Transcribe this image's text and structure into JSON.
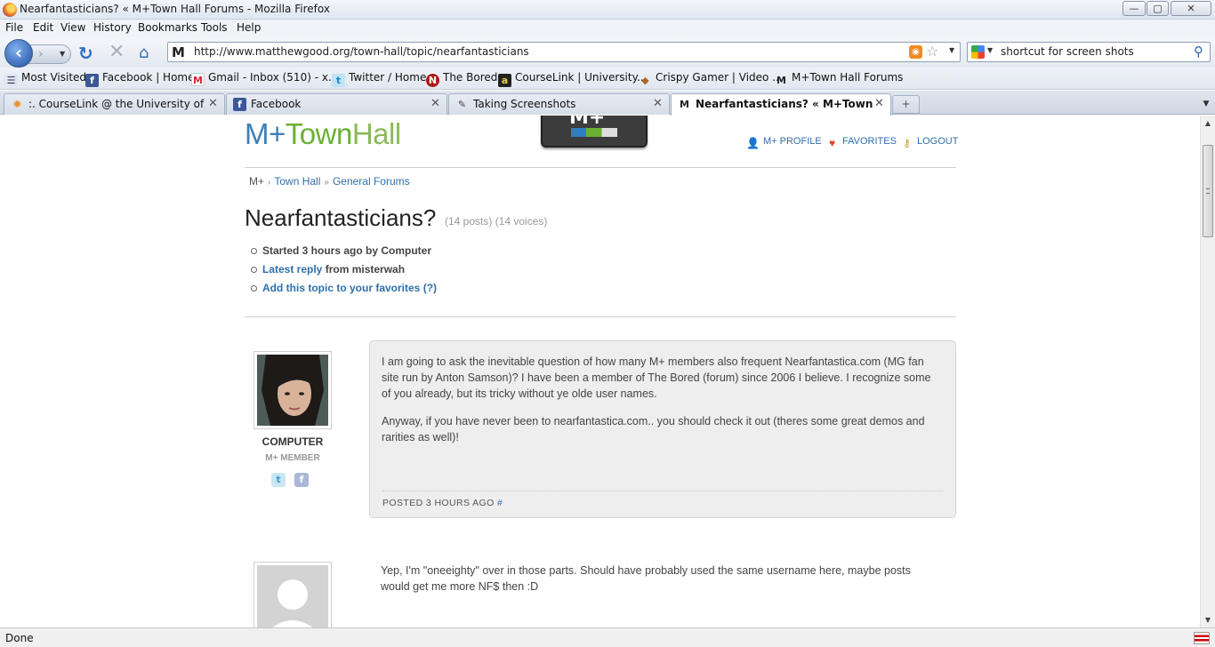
{
  "window": {
    "title": "Nearfantasticians? « M+Town Hall Forums - Mozilla Firefox",
    "min_glyph": "—",
    "max_glyph": "▢",
    "close_glyph": "✕"
  },
  "menu": [
    "File",
    "Edit",
    "View",
    "History",
    "Bookmarks",
    "Tools",
    "Help"
  ],
  "nav": {
    "back_glyph": "‹",
    "forward_glyph": "›",
    "reload_glyph": "↻",
    "stop_glyph": "✕",
    "home_glyph": "⌂",
    "url": "http://www.matthewgood.org/town-hall/topic/nearfantasticians",
    "site_icon": "M",
    "search_query": "shortcut for screen shots",
    "search_glyph": "⚲"
  },
  "bookmarks": [
    {
      "label": "Most Visited",
      "icon": "most-visited-icon"
    },
    {
      "label": "Facebook | Home",
      "icon": "facebook-icon"
    },
    {
      "label": "Gmail - Inbox (510) - x...",
      "icon": "gmail-icon"
    },
    {
      "label": "Twitter / Home",
      "icon": "twitter-icon"
    },
    {
      "label": "The Bored",
      "icon": "the-bored-icon"
    },
    {
      "label": "CourseLink | University...",
      "icon": "courselink-icon"
    },
    {
      "label": "Crispy Gamer | Video ...",
      "icon": "crispy-gamer-icon"
    },
    {
      "label": "M+Town Hall Forums",
      "icon": "mplus-icon"
    }
  ],
  "tabs": [
    {
      "label": ":. CourseLink @ the University of Gu...",
      "active": false
    },
    {
      "label": "Facebook",
      "active": false
    },
    {
      "label": "Taking Screenshots",
      "active": false
    },
    {
      "label": "Nearfantasticians? « M+Town Hall...",
      "active": true
    }
  ],
  "status": "Done",
  "site": {
    "logo_m": "M+",
    "logo_town": "Town",
    "logo_hall": "Hall",
    "cassette_label": "M+",
    "user_nav": {
      "profile": "M+ PROFILE",
      "favorites": "FAVORITES",
      "logout": "LOGOUT"
    },
    "breadcrumb": {
      "root": "M+",
      "town_hall": "Town Hall",
      "general": "General Forums"
    }
  },
  "topic": {
    "title": "Nearfantasticians?",
    "meta": "(14 posts) (14 voices)",
    "started": "Started 3 hours ago by Computer",
    "latest_reply_link": "Latest reply",
    "latest_reply_from": " from misterwah",
    "add_favorites_link": "Add this topic to your favorites",
    "help_link": "(?)"
  },
  "posts": [
    {
      "author": "COMPUTER",
      "role": "M+ MEMBER",
      "paragraphs": [
        "I am going to ask the inevitable question of how many M+ members also frequent Nearfantastica.com (MG fan site run by Anton Samson)? I have been a member of The Bored (forum) since 2006 I believe. I recognize some of you already, but its tricky without ye olde user names.",
        "Anyway, if you have never been to nearfantastica.com.. you should check it out (theres some great demos and rarities as well)!"
      ],
      "posted": "POSTED 3 HOURS AGO",
      "permalink": "#"
    },
    {
      "author": "",
      "role": "",
      "paragraphs": [
        "Yep, I'm \"oneeighty\" over in those parts. Should have probably used the same username here, maybe posts would get me more NF$ then :D"
      ]
    }
  ],
  "colors": {
    "link": "#2f6fab",
    "logo_blue": "#3d7fb8",
    "logo_green": "#6ab033",
    "post_bg": "#eeeeee"
  }
}
